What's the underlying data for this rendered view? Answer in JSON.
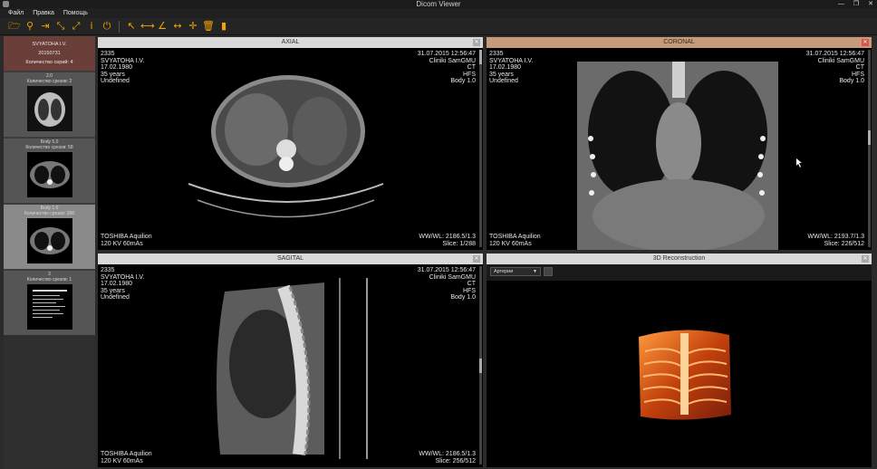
{
  "window": {
    "title": "Dicom Viewer",
    "controls": [
      "—",
      "❐",
      "✕"
    ]
  },
  "menu": [
    "Файл",
    "Правка",
    "Помощь"
  ],
  "toolbar": {
    "buttons": [
      {
        "name": "open-folder-icon",
        "glyph": "🗁"
      },
      {
        "name": "open-file-icon",
        "glyph": "⚲"
      },
      {
        "name": "import-icon",
        "glyph": "⇥"
      },
      {
        "name": "zoom-icon",
        "glyph": "⤡"
      },
      {
        "name": "fullscreen-icon",
        "glyph": "⤢"
      },
      {
        "name": "info-icon",
        "glyph": "i"
      },
      {
        "name": "power-icon",
        "glyph": "⏻"
      },
      {
        "name": "pointer-icon",
        "glyph": "↖"
      },
      {
        "name": "ruler-icon",
        "glyph": "⟷"
      },
      {
        "name": "angle-icon",
        "glyph": "∠"
      },
      {
        "name": "distance-icon",
        "glyph": "↔"
      },
      {
        "name": "crosshair-icon",
        "glyph": "✛"
      },
      {
        "name": "delete-icon",
        "glyph": "🗑"
      },
      {
        "name": "contrast-icon",
        "glyph": "▮"
      }
    ]
  },
  "patient": {
    "name": "SVYATOHA I.V.",
    "date": "20150731",
    "series_count": "Количество серий: 4"
  },
  "series": [
    {
      "title": "2.0",
      "slices": "Количество срезов: 2",
      "active": false
    },
    {
      "title": "Body 5.0",
      "slices": "Количество срезов: 58",
      "active": false
    },
    {
      "title": "Body 1.0",
      "slices": "Количество срезов: 288",
      "active": true
    },
    {
      "title": "3",
      "slices": "Количество срезов: 1",
      "active": false
    }
  ],
  "axial": {
    "title": "AXIAL",
    "tl": [
      "2335",
      "SVYATOHA I.V.",
      "17.02.1980",
      "35 years",
      "Undefined"
    ],
    "tr": [
      "31.07.2015 12:56:47",
      "Cliniki SamGMU",
      "CT",
      "HFS",
      "Body 1.0"
    ],
    "bl": [
      "TOSHIBA  Aquilion",
      "120 KV 60mAs"
    ],
    "br": [
      "WW/WL: 2186.5/1.3",
      "Slice: 1/288"
    ],
    "slice_fraction": 0.0
  },
  "coronal": {
    "title": "CORONAL",
    "tl": [
      "2335",
      "SVYATOHA I.V.",
      "17.02.1980",
      "35 years",
      "Undefined"
    ],
    "tr": [
      "31.07.2015 12:56:47",
      "Cliniki SamGMU",
      "CT",
      "HFS",
      "Body 1.0"
    ],
    "bl": [
      "TOSHIBA  Aquilion",
      "120 KV 60mAs"
    ],
    "br": [
      "WW/WL: 2193.7/1.3",
      "Slice: 226/512"
    ],
    "slice_fraction": 0.44
  },
  "sagital": {
    "title": "SAGITAL",
    "tl": [
      "2335",
      "SVYATOHA I.V.",
      "17.02.1980",
      "35 years",
      "Undefined"
    ],
    "tr": [
      "31.07.2015 12:56:47",
      "Cliniki SamGMU",
      "CT",
      "HFS",
      "Body 1.0"
    ],
    "bl": [
      "TOSHIBA  Aquilion",
      "120 KV 60mAs"
    ],
    "br": [
      "WW/WL: 2186.5/1.3",
      "Slice: 256/512"
    ],
    "slice_fraction": 0.5
  },
  "recon": {
    "title": "3D Reconstruction",
    "preset": "Артерии"
  },
  "colors": {
    "accent": "#f2a400",
    "active_header": "#c79b78",
    "patient_card": "#6a3f3a"
  }
}
